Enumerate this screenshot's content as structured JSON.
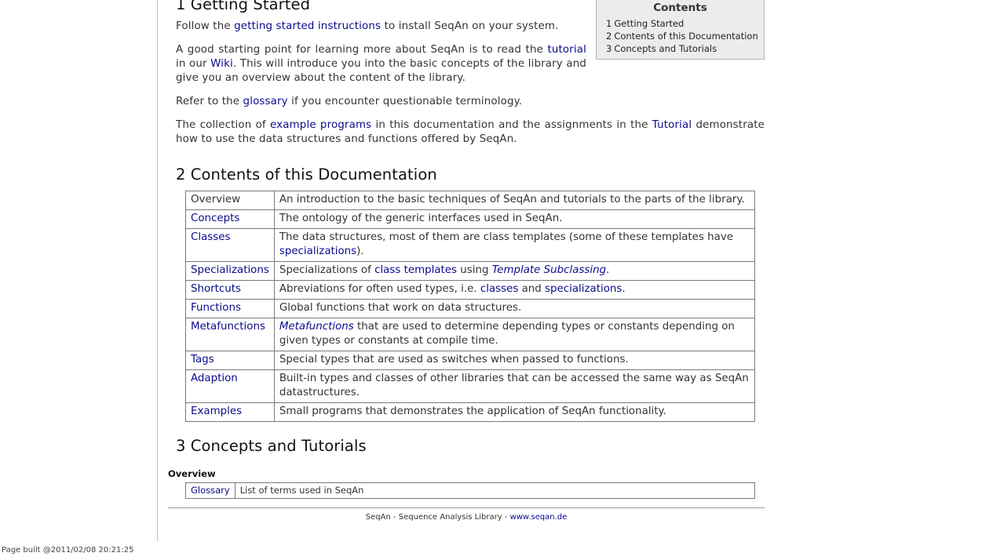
{
  "toc": {
    "title": "Contents",
    "items": [
      {
        "num": "1",
        "label": "Getting Started"
      },
      {
        "num": "2",
        "label": "Contents of this Documentation"
      },
      {
        "num": "3",
        "label": "Concepts and Tutorials"
      }
    ]
  },
  "getting_started": {
    "heading": "1 Getting Started",
    "follow": {
      "pre": "Follow the ",
      "link": "getting started instructions",
      "post": " to install SeqAn on your system."
    },
    "start": {
      "pre": "A good starting point for learning more about SeqAn is to read the ",
      "link1": "tutorial",
      "mid": " in our ",
      "link2": "Wiki",
      "post": ". This will introduce you into the basic concepts of the library and give you an overview about the content of the library."
    },
    "refer": {
      "pre": "Refer to the ",
      "link": "glossary",
      "post": " if you encounter questionable terminology."
    },
    "collection": {
      "pre": "The collection of ",
      "link1": "example programs",
      "mid": " in this documentation and the assignments in the ",
      "link2": "Tutorial",
      "post": " demonstrate how to use the data structures and functions offered by SeqAn."
    }
  },
  "contents": {
    "heading": "2 Contents of this Documentation",
    "rows": {
      "overview": {
        "key": "Overview",
        "desc": "An introduction to the basic techniques of SeqAn and tutorials to the parts of the library."
      },
      "concepts": {
        "key": "Concepts",
        "desc": "The ontology of the generic interfaces used in SeqAn."
      },
      "classes": {
        "key": "Classes",
        "pre": "The data structures, most of them are class templates (some of these templates have ",
        "link": "specializations",
        "post": ")."
      },
      "specializations": {
        "key": "Specializations",
        "pre": "Specializations of ",
        "link": "class templates",
        "mid": " using ",
        "italic": "Template Subclassing",
        "post": "."
      },
      "shortcuts": {
        "key": "Shortcuts",
        "pre": "Abreviations for often used types, i.e. ",
        "link1": "classes",
        "mid": " and ",
        "link2": "specializations",
        "post": "."
      },
      "functions": {
        "key": "Functions",
        "desc": "Global functions that work on data structures."
      },
      "metafunctions": {
        "key": "Metafunctions",
        "italic": "Metafunctions",
        "post": " that are used to determine depending types or constants depending on given types or constants at compile time."
      },
      "tags": {
        "key": "Tags",
        "desc": "Special types that are used as switches when passed to functions."
      },
      "adaption": {
        "key": "Adaption",
        "desc": "Built-in types and classes of other libraries that can be accessed the same way as SeqAn datastructures."
      },
      "examples": {
        "key": "Examples",
        "desc": "Small programs that demonstrates the application of SeqAn functionality."
      }
    }
  },
  "concepts_tutorials": {
    "heading": "3 Concepts and Tutorials",
    "overview_label": "Overview",
    "glossary": {
      "key": "Glossary",
      "desc": "List of terms used in SeqAn"
    }
  },
  "footer": {
    "text": "SeqAn - Sequence Analysis Library - ",
    "link": "www.seqan.de"
  },
  "built": "Page built @2011/02/08 20:21:25",
  "colors": {
    "link": "#0a0a8c",
    "toc_bg": "#ececec",
    "border": "#7a7a7a"
  }
}
